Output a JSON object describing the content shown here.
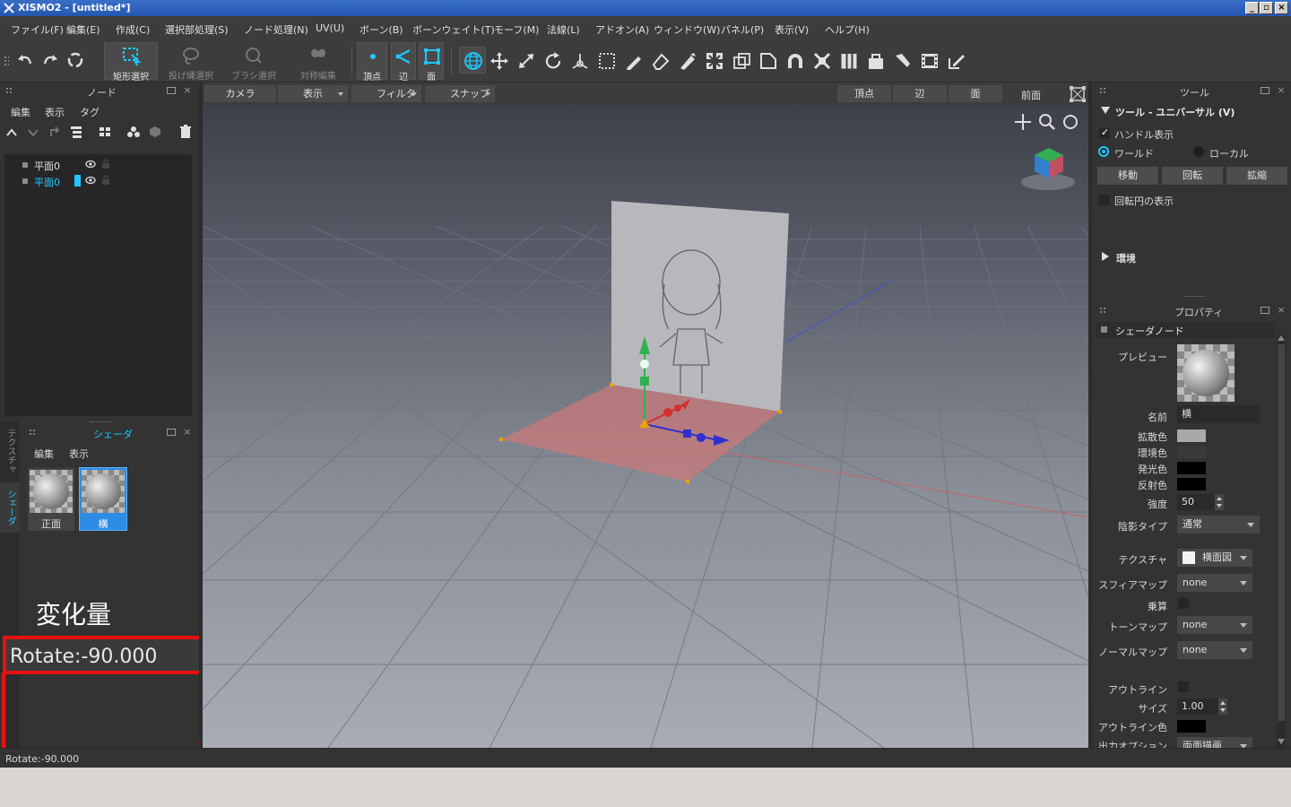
{
  "window": {
    "title": "XISMO2 - [untitled*]"
  },
  "menu": [
    "ファイル(F)",
    "編集(E)",
    "作成(C)",
    "選択部処理(S)",
    "ノード処理(N)",
    "UV(U)",
    "ボーン(B)",
    "ボーンウェイト(T)",
    "モーフ(M)",
    "法線(L)",
    "アドオン(A)",
    "ウィンドウ(W)",
    "パネル(P)",
    "表示(V)",
    "ヘルプ(H)"
  ],
  "toolbar": {
    "rect_select": "矩形選択",
    "lasso_select": "投げ縄選択",
    "brush_select": "ブラシ選択",
    "symmetry_edit": "対称編集",
    "vertex": "頂点",
    "edge": "辺",
    "face": "面"
  },
  "node_panel": {
    "title": "ノード",
    "menu": [
      "編集",
      "表示",
      "タグ"
    ],
    "items": [
      {
        "label": "平面0",
        "selected": false
      },
      {
        "label": "平面0",
        "selected": true
      }
    ]
  },
  "shader_panel": {
    "title": "シェーダ",
    "menu": [
      "編集",
      "表示"
    ],
    "side_tabs": [
      "テクスチャ",
      "シェーダ"
    ],
    "items": [
      {
        "label": "正面",
        "selected": false
      },
      {
        "label": "横",
        "selected": true
      }
    ]
  },
  "annotation": {
    "heading": "変化量",
    "value": "Rotate:-90.000",
    "color": "#e81010"
  },
  "viewport_toolbar": {
    "camera": "カメラ",
    "display": "表示",
    "filter": "フィルタ",
    "snap": "スナップ",
    "vertex": "頂点",
    "edge": "辺",
    "face": "面",
    "view": "前面"
  },
  "tool_panel": {
    "title": "ツール",
    "section": "ツール - ユニバーサル (V)",
    "handle_display": "ハンドル表示",
    "world": "ワールド",
    "local": "ローカル",
    "move": "移動",
    "rotate": "回転",
    "scale": "拡縮",
    "show_rotation_circle": "回転円の表示",
    "environment": "環境"
  },
  "property_panel": {
    "title": "プロパティ",
    "section": "シェーダノード",
    "preview_label": "プレビュー",
    "name_label": "名前",
    "name_value": "横",
    "diffuse_label": "拡散色",
    "ambient_label": "環境色",
    "emissive_label": "発光色",
    "specular_label": "反射色",
    "strength_label": "強度",
    "strength_value": "50",
    "shading_type_label": "陰影タイプ",
    "shading_type_value": "通常",
    "texture_label": "テクスチャ",
    "texture_value": "横面図",
    "sphere_map_label": "スフィアマップ",
    "sphere_map_value": "none",
    "multiply_label": "乗算",
    "toon_map_label": "トーンマップ",
    "toon_map_value": "none",
    "normal_map_label": "ノーマルマップ",
    "normal_map_value": "none",
    "outline_label": "アウトライン",
    "size_label": "サイズ",
    "size_value": "1.00",
    "outline_color_label": "アウトライン色",
    "output_option_label": "出力オプション",
    "output_option_value": "両面描画",
    "colors": {
      "diffuse": "#a9a9a9",
      "ambient": "#3a3a3a",
      "emissive": "#000000",
      "specular": "#000000",
      "outline": "#000000"
    }
  },
  "statusbar": {
    "text": "Rotate:-90.000"
  },
  "colors": {
    "accent": "#1ec8ff",
    "selection": "#2d8de6"
  }
}
